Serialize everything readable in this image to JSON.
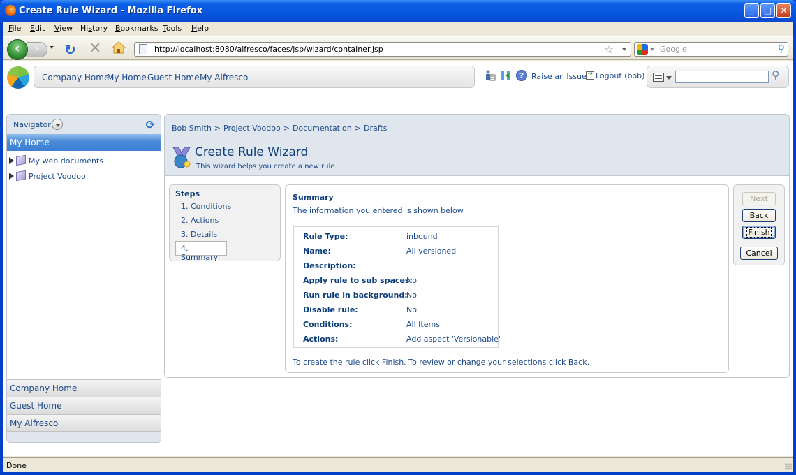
{
  "window": {
    "title": "Create Rule Wizard - Mozilla Firefox",
    "controls": {
      "minimize": "_",
      "maximize": "□",
      "close": "✕"
    }
  },
  "menubar": {
    "items": [
      {
        "label": "File",
        "accel": "F",
        "rest": "ile"
      },
      {
        "label": "Edit",
        "accel": "E",
        "rest": "dit"
      },
      {
        "label": "View",
        "accel": "V",
        "rest": "iew"
      },
      {
        "label": "History",
        "accel": "s",
        "pre": "Hi",
        "rest": "tory"
      },
      {
        "label": "Bookmarks",
        "accel": "B",
        "rest": "ookmarks"
      },
      {
        "label": "Tools",
        "accel": "T",
        "rest": "ools"
      },
      {
        "label": "Help",
        "accel": "H",
        "rest": "elp"
      }
    ]
  },
  "navbar": {
    "back_glyph": "‹",
    "forward_glyph": "›",
    "reload_glyph": "↻",
    "stop_glyph": "✕",
    "url": "http://localhost:8080/alfresco/faces/jsp/wizard/container.jsp",
    "bookmark_star": "☆",
    "search_placeholder": "Google",
    "search_glyph": "⚲"
  },
  "alfresco_header": {
    "links": [
      "Company Home",
      "My Home",
      "Guest Home",
      "My Alfresco"
    ],
    "raise_issue": "Raise an Issue",
    "logout": "Logout (bob)",
    "search_value": "",
    "search_glyph": "⚲"
  },
  "navigator": {
    "title": "Navigator",
    "refresh_glyph": "⟳",
    "selected": "My Home",
    "tree": [
      "My web documents",
      "Project Voodoo"
    ],
    "shelves": [
      "Company Home",
      "Guest Home",
      "My Alfresco"
    ]
  },
  "breadcrumb": {
    "items": [
      "Bob Smith",
      "Project Voodoo",
      "Documentation",
      "Drafts"
    ],
    "separator": ">"
  },
  "wizard": {
    "title": "Create Rule Wizard",
    "description": "This wizard helps you create a new rule.",
    "steps_title": "Steps",
    "steps": [
      "1. Conditions",
      "2. Actions",
      "3. Details",
      "4. Summary"
    ],
    "active_step": 4,
    "summary": {
      "title": "Summary",
      "description": "The information you entered is shown below.",
      "rows": [
        {
          "key": "Rule Type:",
          "value": "inbound"
        },
        {
          "key": "Name:",
          "value": "All versioned"
        },
        {
          "key": "Description:",
          "value": ""
        },
        {
          "key": "Apply rule to sub spaces:",
          "value": "No"
        },
        {
          "key": "Run rule in background:",
          "value": "No"
        },
        {
          "key": "Disable rule:",
          "value": "No"
        },
        {
          "key": "Conditions:",
          "value": "All Items"
        },
        {
          "key": "Actions:",
          "value": "Add aspect 'Versionable'"
        }
      ],
      "footer": "To create the rule click Finish. To review or change your selections click Back."
    },
    "buttons": {
      "next": "Next",
      "back": "Back",
      "finish": "Finish",
      "cancel": "Cancel"
    }
  },
  "statusbar": {
    "text": "Done"
  }
}
